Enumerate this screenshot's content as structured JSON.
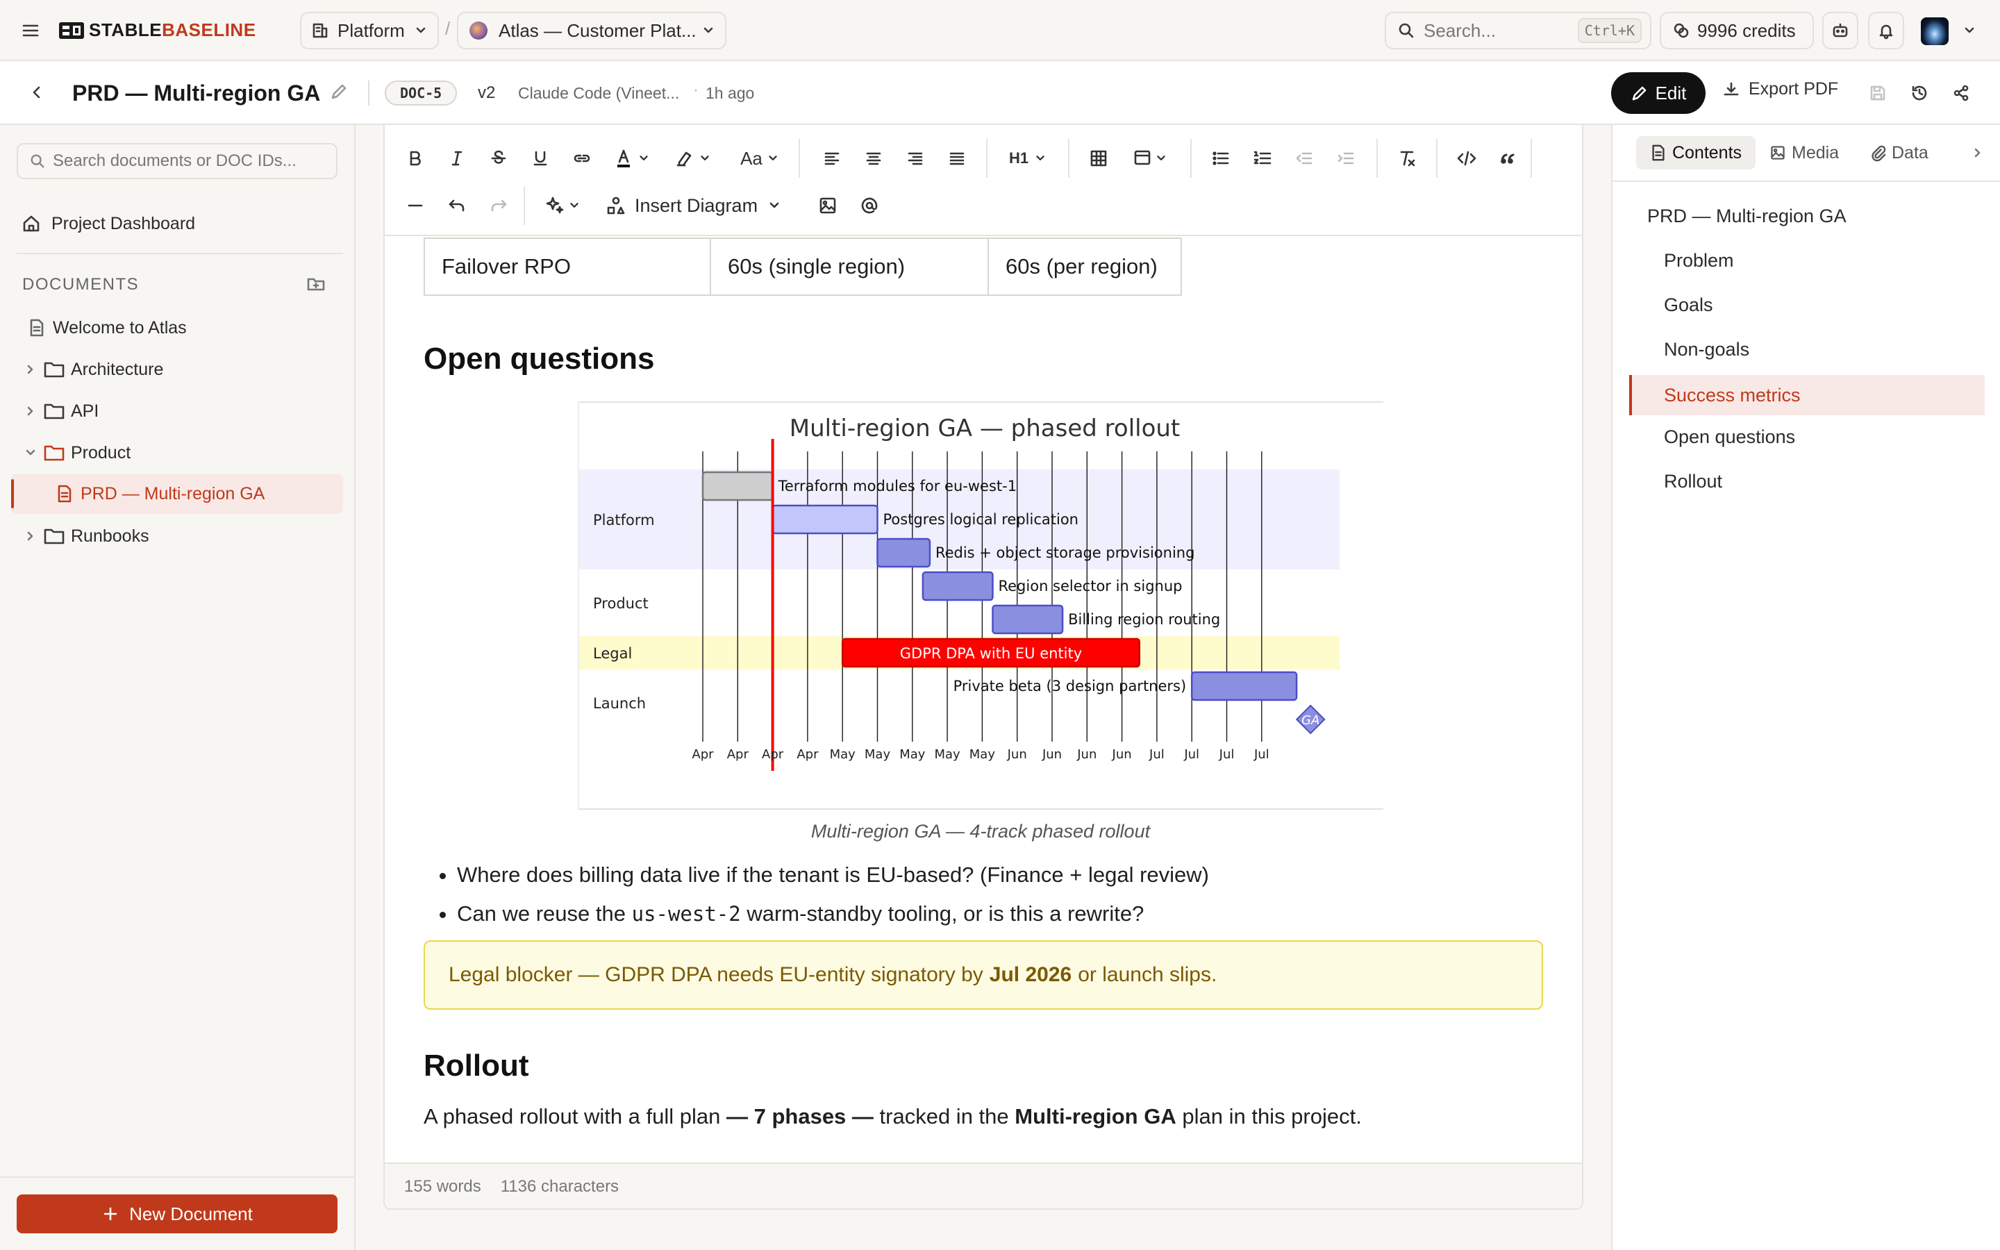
{
  "topbar": {
    "brand": "STABLEBASELINE",
    "workspace": "Platform",
    "project": "Atlas — Customer Plat...",
    "search_placeholder": "Search...",
    "search_shortcut": "Ctrl+K",
    "credits": "9996 credits"
  },
  "doc_header": {
    "title": "PRD — Multi-region GA",
    "doc_id": "DOC-5",
    "version": "v2",
    "author": "Claude Code (Vineet...",
    "updated": "1h ago",
    "edit_label": "Edit",
    "export_label": "Export PDF"
  },
  "sidebar": {
    "search_placeholder": "Search documents or DOC IDs...",
    "dashboard": "Project Dashboard",
    "section_label": "DOCUMENTS",
    "items": [
      {
        "label": "Welcome to Atlas",
        "type": "doc"
      },
      {
        "label": "Architecture",
        "type": "folder"
      },
      {
        "label": "API",
        "type": "folder"
      },
      {
        "label": "Product",
        "type": "folder-open"
      },
      {
        "label": "PRD — Multi-region GA",
        "type": "doc-active"
      },
      {
        "label": "Runbooks",
        "type": "folder"
      }
    ],
    "new_doc_label": "New Document"
  },
  "toolbar": {
    "font_size_label": "Aa",
    "heading_label": "H1",
    "insert_diagram_label": "Insert Diagram"
  },
  "content": {
    "table_row": [
      "Failover RPO",
      "60s (single region)",
      "60s (per region)"
    ],
    "h_open_questions": "Open questions",
    "figure_caption": "Multi-region GA — 4-track phased rollout",
    "bullets": [
      {
        "pre": "Where does billing data live if the tenant is EU-based? (Finance + legal review)",
        "code": "",
        "post": ""
      },
      {
        "pre": "Can we reuse the ",
        "code": "us-west-2",
        "post": " warm-standby tooling, or is this a rewrite?"
      }
    ],
    "callout": {
      "pre": "Legal blocker — GDPR DPA needs EU-entity signatory by ",
      "bold": "Jul 2026",
      "post": " or launch slips."
    },
    "h_rollout": "Rollout",
    "rollout_para": {
      "a": "A phased rollout with a full plan ",
      "b": "— 7 phases —",
      "c": " tracked in the ",
      "d": "Multi-region GA",
      "e": " plan in this project."
    }
  },
  "statusbar": {
    "words": "155 words",
    "chars": "1136 characters"
  },
  "rightnav": {
    "tabs": [
      "Contents",
      "Media",
      "Data"
    ],
    "toc": [
      {
        "label": "PRD — Multi-region GA",
        "level": 1
      },
      {
        "label": "Problem",
        "level": 2
      },
      {
        "label": "Goals",
        "level": 2
      },
      {
        "label": "Non-goals",
        "level": 2
      },
      {
        "label": "Success metrics",
        "level": 2,
        "active": true
      },
      {
        "label": "Open questions",
        "level": 2
      },
      {
        "label": "Rollout",
        "level": 2
      }
    ]
  },
  "colors": {
    "accent": "#c0391b",
    "active_bg": "#f9e9e6",
    "callout_bg": "#fefbe3",
    "callout_border": "#e9d84a",
    "gantt_bar": "#8b8fe0",
    "gantt_critical": "#ff0000",
    "today_line": "#ff0000"
  },
  "chart_data": {
    "type": "gantt",
    "title": "Multi-region GA — phased rollout",
    "sections": [
      "Platform",
      "Product",
      "Legal",
      "Launch"
    ],
    "tasks": [
      {
        "name": "Terraform modules for eu-west-1",
        "section": "Platform",
        "start": 0,
        "end": 2,
        "status": "done"
      },
      {
        "name": "Postgres logical replication",
        "section": "Platform",
        "start": 2,
        "end": 5,
        "status": "active"
      },
      {
        "name": "Redis + object storage provisioning",
        "section": "Platform",
        "start": 5,
        "end": 6.5,
        "status": "planned"
      },
      {
        "name": "Region selector in signup",
        "section": "Product",
        "start": 6.3,
        "end": 8.3,
        "status": "planned"
      },
      {
        "name": "Billing region routing",
        "section": "Product",
        "start": 8.3,
        "end": 10.3,
        "status": "planned"
      },
      {
        "name": "GDPR DPA with EU entity",
        "section": "Legal",
        "start": 4,
        "end": 12.5,
        "status": "critical"
      },
      {
        "name": "Private beta (3 design partners)",
        "section": "Launch",
        "start": 14,
        "end": 17,
        "status": "planned"
      },
      {
        "name": "GA",
        "section": "Launch",
        "start": 17.4,
        "end": 17.4,
        "status": "milestone"
      }
    ],
    "today": 2,
    "x_ticks": [
      "Apr",
      "Apr",
      "Apr",
      "Apr",
      "May",
      "May",
      "May",
      "May",
      "May",
      "Jun",
      "Jun",
      "Jun",
      "Jun",
      "Jul",
      "Jul",
      "Jul",
      "Jul"
    ]
  }
}
